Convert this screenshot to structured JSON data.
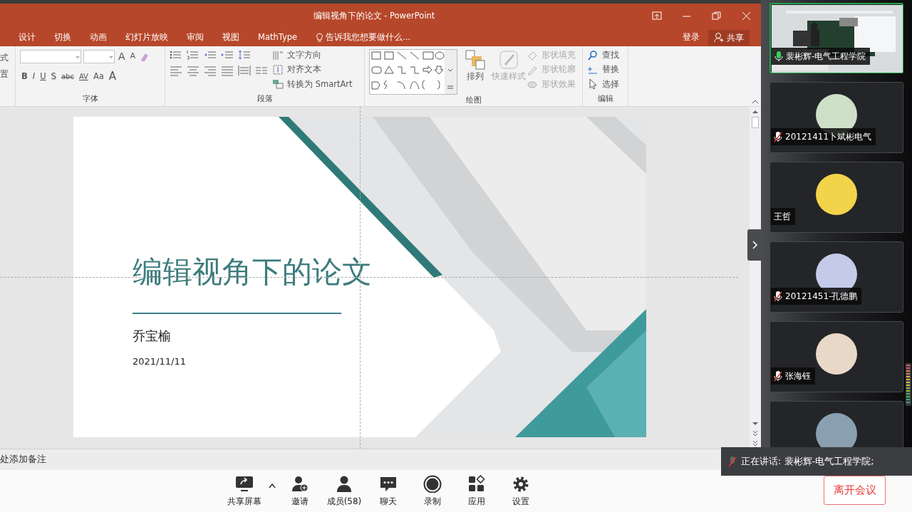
{
  "powerpoint": {
    "title": "编辑视角下的论文 - PowerPoint",
    "tabs": [
      "设计",
      "切换",
      "动画",
      "幻灯片放映",
      "审阅",
      "视图",
      "MathType"
    ],
    "tell_me": "告诉我您想要做什么...",
    "sign_in": "登录",
    "share": "共享",
    "ribbon": {
      "cut_labels": [
        "式",
        "置"
      ],
      "font": {
        "label": "字体",
        "buttons": [
          {
            "text": "A",
            "kind": "grow"
          },
          {
            "text": "A",
            "kind": "shrink"
          },
          {
            "text": "B",
            "kind": "bold"
          },
          {
            "text": "I",
            "kind": "italic"
          },
          {
            "text": "U",
            "kind": "underline"
          },
          {
            "text": "S",
            "kind": "shadow"
          },
          {
            "text": "abc",
            "kind": "strike"
          },
          {
            "text": "AV",
            "kind": "spacing"
          },
          {
            "text": "Aa",
            "kind": "case"
          },
          {
            "text": "A",
            "kind": "color"
          }
        ]
      },
      "paragraph": {
        "label": "段落",
        "commands": [
          "文字方向",
          "对齐文本",
          "转换为 SmartArt"
        ]
      },
      "drawing": {
        "label": "绘图",
        "commands": [
          {
            "label": "排列",
            "kind": "large",
            "disabled": false
          },
          {
            "label": "快速样式",
            "kind": "large",
            "disabled": true
          },
          {
            "label": "形状填充",
            "kind": "small",
            "disabled": true
          },
          {
            "label": "形状轮廓",
            "kind": "small",
            "disabled": true
          },
          {
            "label": "形状效果",
            "kind": "small",
            "disabled": true
          }
        ]
      },
      "editing": {
        "label": "编辑",
        "commands": [
          "查找",
          "替换",
          "选择"
        ]
      }
    },
    "slide": {
      "title": "编辑视角下的论文",
      "author": "乔宝榆",
      "date": "2021/11/11"
    },
    "notes_placeholder": "处添加备注"
  },
  "participants": [
    {
      "name": "裴彬辉-电气工程学院",
      "kind": "video",
      "mic_shown": true,
      "muted": false,
      "speaking": true
    },
    {
      "name": "20121411卜斌彬电气",
      "kind": "avatar",
      "mic_shown": true,
      "muted": true,
      "speaking": false
    },
    {
      "name": "王哲",
      "kind": "avatar",
      "mic_shown": false,
      "speaking": false
    },
    {
      "name": "20121451-孔德鹏",
      "kind": "avatar",
      "mic_shown": true,
      "muted": true,
      "speaking": false
    },
    {
      "name": "张海钰",
      "kind": "avatar",
      "mic_shown": true,
      "muted": true,
      "speaking": false
    },
    {
      "kind": "avatar",
      "speaking": false
    }
  ],
  "toolbar": [
    {
      "label": "共享屏幕",
      "kind": "share"
    },
    {
      "label": "邀请",
      "kind": "invite"
    },
    {
      "label": "成员(58)",
      "kind": "members"
    },
    {
      "label": "聊天",
      "kind": "chat"
    },
    {
      "label": "录制",
      "kind": "record"
    },
    {
      "label": "应用",
      "kind": "apps"
    },
    {
      "label": "设置",
      "kind": "settings"
    }
  ],
  "leave_button": "离开会议",
  "speaking_toast": "正在讲话: 裴彬辉-电气工程学院;"
}
